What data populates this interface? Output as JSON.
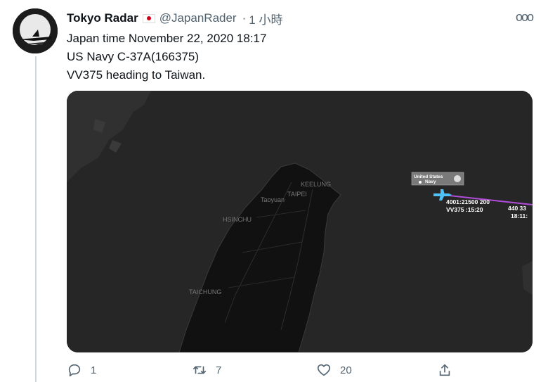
{
  "tweet": {
    "author_name": "Tokyo Radar",
    "handle": "@JapanRader",
    "separator": "·",
    "time": "1 小時",
    "more_label": "ooo",
    "lines": [
      "Japan time November 22, 2020 18:17",
      "US Navy C-37A(166375)",
      "VV375 heading to Taiwan."
    ]
  },
  "map": {
    "labels": {
      "keelung": "KEELUNG",
      "taipei": "TAIPEI",
      "taoyuan": "Taoyuan",
      "hsinchu": "HSINCHU",
      "taichung": "TAICHUNG"
    },
    "flight_box": {
      "line1": "United States",
      "line2": "Navy"
    },
    "flight_info": {
      "alt_speed": "4001:21500 200",
      "callsign_time": "VV375 :15:20",
      "trail_alt": "440  33",
      "trail_time": "18:11:"
    }
  },
  "actions": {
    "reply_count": "1",
    "retweet_count": "7",
    "like_count": "20"
  },
  "colors": {
    "thread_line": "#cfd9de",
    "muted_text": "#536471",
    "map_bg": "#262626",
    "aircraft": "#4fc3f7",
    "trail": "#b04cd9"
  }
}
